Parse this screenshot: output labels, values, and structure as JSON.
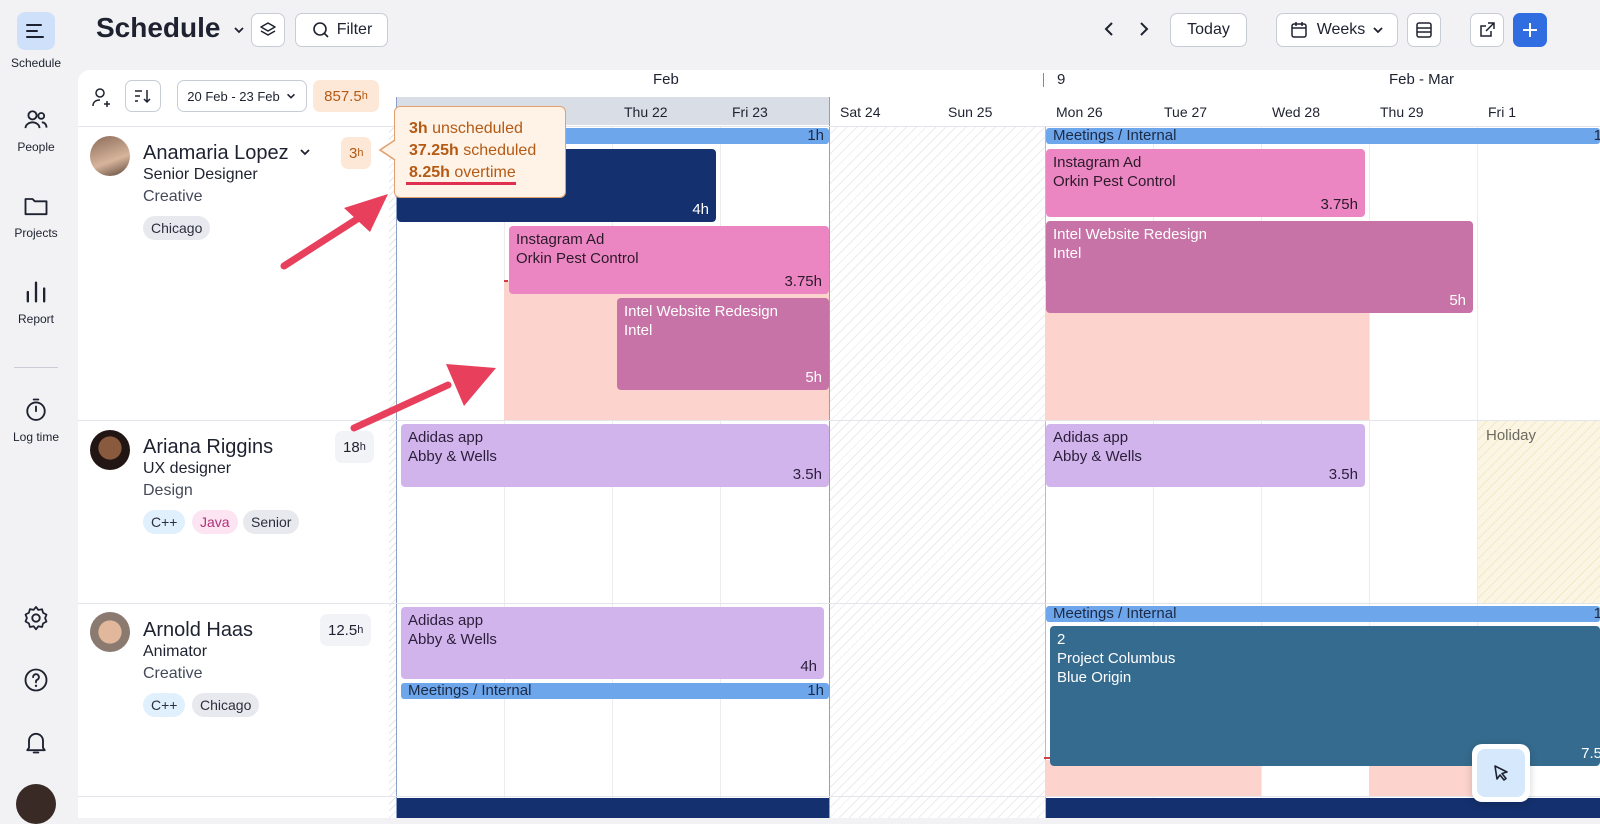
{
  "rail": {
    "schedule": "Schedule",
    "people": "People",
    "projects": "Projects",
    "report": "Report",
    "log_time": "Log time"
  },
  "topbar": {
    "title": "Schedule",
    "filter": "Filter",
    "today": "Today",
    "view": "Weeks"
  },
  "panel": {
    "date_range": "20 Feb - 23 Feb",
    "total_hours": "857.5",
    "total_unit": "h"
  },
  "months": {
    "left": "Feb",
    "week": "9",
    "right": "Feb - Mar"
  },
  "days": [
    "Thu 22",
    "Fri 23",
    "Sat 24",
    "Sun 25",
    "Mon 26",
    "Tue 27",
    "Wed 28",
    "Thu 29",
    "Fri 1"
  ],
  "tooltip": {
    "unscheduled_val": "3h",
    "unscheduled_txt": "unscheduled",
    "scheduled_val": "37.25h",
    "scheduled_txt": "scheduled",
    "overtime_val": "8.25h",
    "overtime_txt": "overtime"
  },
  "people": [
    {
      "name": "Anamaria Lopez",
      "role": "Senior Designer",
      "dept": "Creative",
      "hours": "3",
      "hours_unit": "h",
      "tags": [
        "Chicago"
      ]
    },
    {
      "name": "Ariana Riggins",
      "role": "UX designer",
      "dept": "Design",
      "hours": "18",
      "hours_unit": "h",
      "tags": [
        "C++",
        "Java",
        "Senior"
      ]
    },
    {
      "name": "Arnold Haas",
      "role": "Animator",
      "dept": "Creative",
      "hours": "12.5",
      "hours_unit": "h",
      "tags": [
        "C++",
        "Chicago"
      ]
    }
  ],
  "blocks": {
    "meet1_a": {
      "title": "",
      "hours": "1h"
    },
    "meet1_b": {
      "title": "Meetings / Internal",
      "hours": "1"
    },
    "navy": {
      "hours": "4h"
    },
    "insta1": {
      "line1": "Instagram Ad",
      "line2": "Orkin Pest Control",
      "hours": "3.75h"
    },
    "insta2": {
      "line1": "Instagram Ad",
      "line2": "Orkin Pest Control",
      "hours": "3.75h"
    },
    "intel1": {
      "line1": "Intel Website Redesign",
      "line2": "Intel",
      "hours": "5h"
    },
    "intel2": {
      "line1": "Intel Website Redesign",
      "line2": "Intel",
      "hours": "5h"
    },
    "adidas1": {
      "line1": "Adidas app",
      "line2": "Abby & Wells",
      "hours": "3.5h"
    },
    "adidas2": {
      "line1": "Adidas app",
      "line2": "Abby & Wells",
      "hours": "3.5h"
    },
    "holiday": {
      "label": "Holiday"
    },
    "adidas3": {
      "line1": "Adidas app",
      "line2": "Abby & Wells",
      "hours": "4h"
    },
    "meet3_a": {
      "title": "Meetings / Internal",
      "hours": "1h"
    },
    "meet3_b": {
      "title": "Meetings / Internal",
      "hours": "1"
    },
    "columbus": {
      "line1": "2",
      "line2": "Project Columbus",
      "line3": "Blue Origin",
      "hours": "7.5"
    }
  }
}
